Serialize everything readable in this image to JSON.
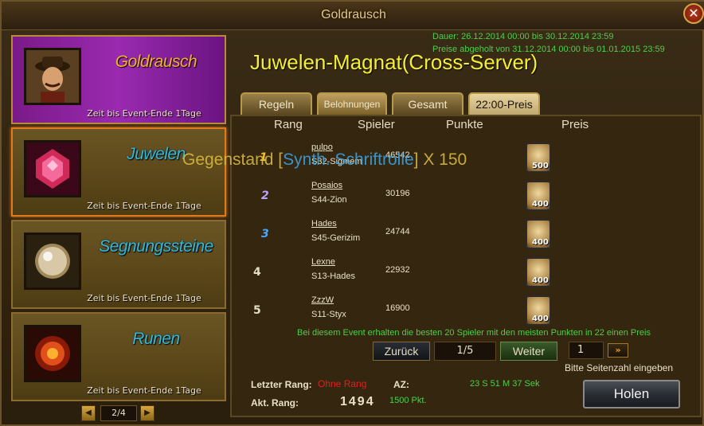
{
  "window": {
    "title": "Goldrausch",
    "close_label": "✕"
  },
  "events": [
    {
      "title": "Goldrausch",
      "subtitle": "Zeit bis Event-Ende 1Tage",
      "icon": "gold-prospector-icon"
    },
    {
      "title": "Juwelen",
      "subtitle": "Zeit bis Event-Ende 1Tage",
      "icon": "ruby-gem-icon"
    },
    {
      "title": "Segnungssteine",
      "subtitle": "Zeit bis Event-Ende 1Tage",
      "icon": "pearl-stone-icon"
    },
    {
      "title": "Runen",
      "subtitle": "Zeit bis Event-Ende 1Tage",
      "icon": "fire-rune-icon"
    }
  ],
  "left_pager": {
    "prev": "◀",
    "page": "2/4",
    "next": "▶"
  },
  "dates": {
    "duration": "Dauer: 26.12.2014 00:00 bis 30.12.2014 23:59",
    "prizes": "Preise abgeholt von 31.12.2014 00:00 bis 01.01.2015 23:59"
  },
  "main_title": "Juwelen-Magnat(Cross-Server)",
  "tabs": [
    {
      "label": "Regeln"
    },
    {
      "label": "Belohnungen"
    },
    {
      "label": "Gesamt"
    },
    {
      "label": "22:00-Preis"
    }
  ],
  "table": {
    "headers": {
      "rank": "Rang",
      "player": "Spieler",
      "points": "Punkte",
      "prize": "Preis"
    },
    "rows": [
      {
        "rank": "1",
        "name": "pulpo",
        "server": "S32-Sigmem",
        "points": "46542",
        "prize": "500"
      },
      {
        "rank": "2",
        "name": "Posaios",
        "server": "S44-Zion",
        "points": "30196",
        "prize": "400"
      },
      {
        "rank": "3",
        "name": "Hades",
        "server": "S45-Gerizim",
        "points": "24744",
        "prize": "400"
      },
      {
        "rank": "4",
        "name": "Lexne",
        "server": "S13-Hades",
        "points": "22932",
        "prize": "400"
      },
      {
        "rank": "5",
        "name": "ZzzW",
        "server": "S11-Styx",
        "points": "16900",
        "prize": "400"
      }
    ]
  },
  "tooltip": {
    "prefix": "Gegenstand [",
    "item": "Synth. Schriftrolle",
    "suffix": "] X 150"
  },
  "info": "Bei diesem Event erhalten die besten 20 Spieler mit den meisten Punkten in 22 einen Preis",
  "pager": {
    "prev": "Zurück",
    "page": "1/5",
    "next": "Weiter",
    "goto_value": "1",
    "goto_btn": "»",
    "goto_hint": "Bitte Seitenzahl eingeben"
  },
  "stats": {
    "last_rank_label": "Letzter Rang:",
    "last_rank_value": "Ohne Rang",
    "current_rank_label": "Akt. Rang:",
    "current_rank_value": "1494",
    "az_label": "AZ:",
    "az_value": "23 S 51 M 37 Sek",
    "points_value": "1500 Pkt."
  },
  "holen_label": "Holen",
  "colors": {
    "accent_green": "#4ad04a",
    "title_yellow": "#f6ee30",
    "last_rank_red": "#e02020"
  }
}
